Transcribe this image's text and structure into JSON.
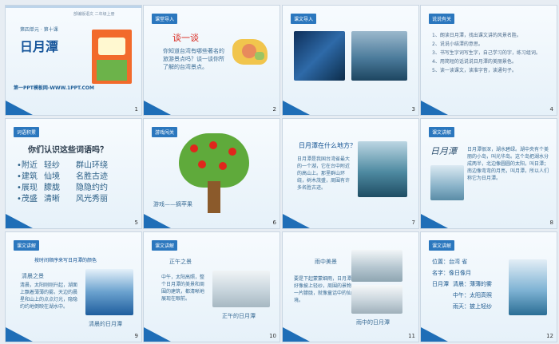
{
  "slides": [
    {
      "num": "1",
      "unit": "第四单元 · 第十课",
      "title": "日月潭",
      "site": "第一PPT模板网-WWW.1PPT.COM",
      "corner_note": "部编版语文 二年级上册"
    },
    {
      "num": "2",
      "tag": "课堂导入",
      "heading": "谈一谈",
      "body": "你知道台湾有哪些著名的旅游景点吗？谈一谈你所了解的台湾景点。"
    },
    {
      "num": "3",
      "tag": "课文导入"
    },
    {
      "num": "4",
      "tag": "说说有关",
      "items": [
        "1、朗读日月潭，找出课文讲的风景名胜。",
        "2、说说小结潭的意思。",
        "3、书写生字词写生字，自己学习的字，练习组词。",
        "4、用简短的话说说日月潭的美丽景色。",
        "5、读一读课文，读准字音，读通句子。"
      ]
    },
    {
      "num": "5",
      "tag": "词语积累",
      "heading": "你们认识这些词语吗？",
      "words": [
        [
          "•附近",
          "轻纱",
          "群山环绕"
        ],
        [
          "•建筑",
          "仙境",
          "名胜古迹"
        ],
        [
          "•展现",
          "朦胧",
          "隐隐约约"
        ],
        [
          "•茂盛",
          "清晰",
          "风光秀丽"
        ]
      ]
    },
    {
      "num": "6",
      "tag": "游戏闯关",
      "caption": "游戏——摘苹果"
    },
    {
      "num": "7",
      "title": "日月潭在什么地方？",
      "body": "日月潭是我国台湾省最大的一个湖，它在台中附近的高山上。那里群山环绕，树木茂盛，周围有许多名胜古迹。"
    },
    {
      "num": "8",
      "tag": "课文讲解",
      "body": "日月潭很深，湖水碧绿。湖中央有个美丽的小岛，叫光华岛。这个岛把湖水分成两半，北边像圆圆的太阳，叫日潭；南边像弯弯的月亮，叫月潭，所以人们称它为日月潭。",
      "title_text": "日月潭"
    },
    {
      "num": "9",
      "tag": "课文讲解",
      "heading": "清晨之景",
      "body": "清晨，太阳刚刚升起，湖面上飘着薄薄的雾。天边的晨星和山上的点点灯光，隐隐约约地倒映在湖水中。",
      "caption": "清晨的日月潭",
      "subtitle": "按时间顺序来写日月潭的颜色"
    },
    {
      "num": "10",
      "tag": "课文讲解",
      "heading": "正午之景",
      "body": "中午，太阳高照，整个日月潭的美景和周围的建筑，都清晰地展现在眼前。",
      "caption": "正午的日月潭"
    },
    {
      "num": "11",
      "heading": "雨中美景",
      "body": "要是下起蒙蒙细雨，日月潭好像披上轻纱，周围的景物一片朦胧，就像童话中的仙境。",
      "caption": "雨中的日月潭"
    },
    {
      "num": "12",
      "tag": "课文讲解",
      "rows": [
        [
          "位置：台湾 省"
        ],
        [
          "名字：像日像月"
        ],
        [
          "日月潭",
          "清晨：薄薄的雾"
        ],
        [
          "中午：太阳高照"
        ],
        [
          "雨天：披上轻纱"
        ]
      ]
    }
  ]
}
